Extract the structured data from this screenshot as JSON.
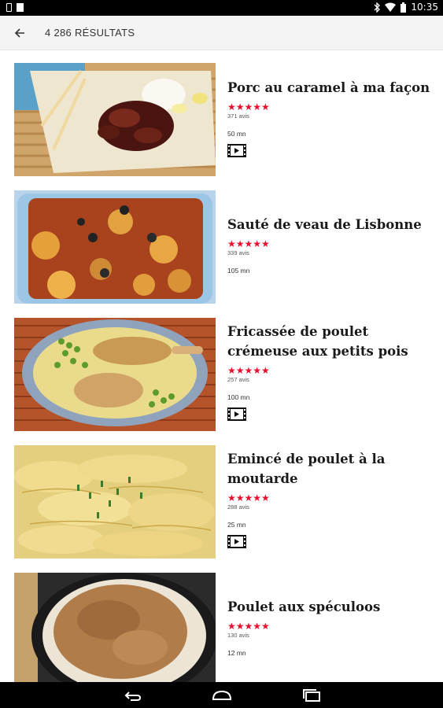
{
  "status_bar": {
    "time": "10:35"
  },
  "app_bar": {
    "title": "4 286 RÉSULTATS"
  },
  "recipes": [
    {
      "title": "Porc au caramel à ma façon",
      "stars": "★★★★★",
      "reviews": "371 avis",
      "time": "50 mn",
      "has_video": true,
      "image": "caramel-pork"
    },
    {
      "title": "Sauté de veau de Lisbonne",
      "stars": "★★★★★",
      "reviews": "339 avis",
      "time": "105 mn",
      "has_video": false,
      "image": "veal-saute"
    },
    {
      "title": "Fricassée de poulet crémeuse aux petits pois",
      "stars": "★★★★★",
      "reviews": "257 avis",
      "time": "100 mn",
      "has_video": true,
      "image": "chicken-fricassee"
    },
    {
      "title": "Emincé de poulet à la moutarde",
      "stars": "★★★★★",
      "reviews": "288 avis",
      "time": "25 mn",
      "has_video": true,
      "image": "chicken-mustard"
    },
    {
      "title": "Poulet aux spéculoos",
      "stars": "★★★★★",
      "reviews": "130 avis",
      "time": "12 mn",
      "has_video": false,
      "image": "chicken-speculoos"
    }
  ],
  "colors": {
    "star_red": "#e8102d",
    "app_bar_bg": "#f4f4f4"
  },
  "icons": {
    "back": "arrow-left-icon",
    "video": "film-icon",
    "nav_back": "nav-back-icon",
    "nav_home": "nav-home-icon",
    "nav_recents": "nav-recents-icon"
  }
}
